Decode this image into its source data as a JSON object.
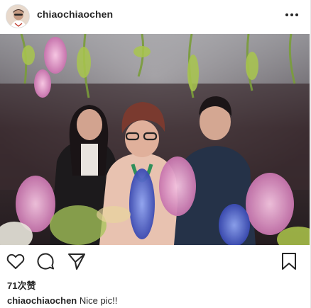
{
  "post": {
    "username": "chiaochiaochen",
    "likes": "71次赞",
    "comment": {
      "username": "chiaochiaochen",
      "text": "Nice pic!!"
    }
  },
  "icons": {
    "more": "more-horizontal-icon",
    "like": "heart-outline-icon",
    "comment": "comment-bubble-icon",
    "share": "paper-plane-icon",
    "save": "bookmark-outline-icon"
  },
  "colors": {
    "text": "#262626",
    "background": "#ffffff"
  }
}
